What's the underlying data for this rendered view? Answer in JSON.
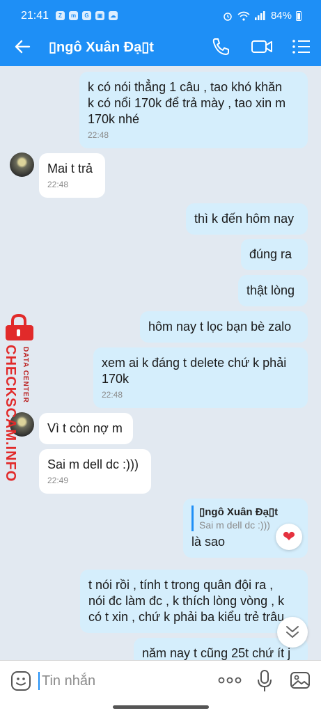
{
  "status_bar": {
    "time": "21:41",
    "battery": "84%",
    "app_icons": [
      "zalo-icon",
      "messenger-icon",
      "google-icon",
      "gallery-icon",
      "cloud-icon"
    ]
  },
  "header": {
    "contact_name": "▯ngô Xuân Đạ▯t",
    "icons": [
      "back-arrow-icon",
      "phone-icon",
      "video-call-icon",
      "menu-icon"
    ]
  },
  "messages": [
    {
      "dir": "out",
      "text_lines": [
        "k có nói thẳng 1 câu , tao khó khăn",
        "k có nổi 170k để trả mày , tao xin m",
        "170k nhé"
      ],
      "time": "22:48"
    },
    {
      "dir": "in",
      "text_lines": [
        "Mai t trả"
      ],
      "time": "22:48"
    },
    {
      "dir": "out",
      "text_lines": [
        "thì k đến hôm nay"
      ]
    },
    {
      "dir": "out",
      "text_lines": [
        "đúng ra"
      ]
    },
    {
      "dir": "out",
      "text_lines": [
        "thật lòng"
      ]
    },
    {
      "dir": "out",
      "text_lines": [
        "hôm nay t lọc bạn bè zalo"
      ]
    },
    {
      "dir": "out",
      "text_lines": [
        "xem ai k đáng t delete chứ k phải",
        "170k"
      ],
      "time": "22:48"
    },
    {
      "dir": "in",
      "text_lines": [
        "Vì t còn nợ m"
      ]
    },
    {
      "dir": "in",
      "text_lines": [
        "Sai m dell dc :)))"
      ],
      "time": "22:49"
    },
    {
      "dir": "out",
      "quote": {
        "name": "▯ngô Xuân Đạ▯t",
        "text": "Sai m dell dc :)))"
      },
      "text_lines": [
        "là sao"
      ]
    },
    {
      "dir": "out",
      "text_lines": [
        "t nói rồi , tính t trong quân đội ra ,",
        "nói đc làm đc , k thích lòng vòng , k",
        "có t xin , chứ k phải ba kiểu trẻ trâu"
      ]
    },
    {
      "dir": "out",
      "text_lines": [
        "năm nay t cũng 25t chứ ít j"
      ]
    }
  ],
  "reaction": "❤",
  "watermark": {
    "brand": "CHECKSCAM.INFO",
    "sub": "DATA CENTER"
  },
  "input": {
    "placeholder": "Tin nhắn"
  },
  "colors": {
    "brand_blue": "#1e8ff6",
    "outgoing_bubble": "#d5eefc",
    "chat_bg": "#e2e9f1",
    "watermark_red": "#e12a2a"
  }
}
